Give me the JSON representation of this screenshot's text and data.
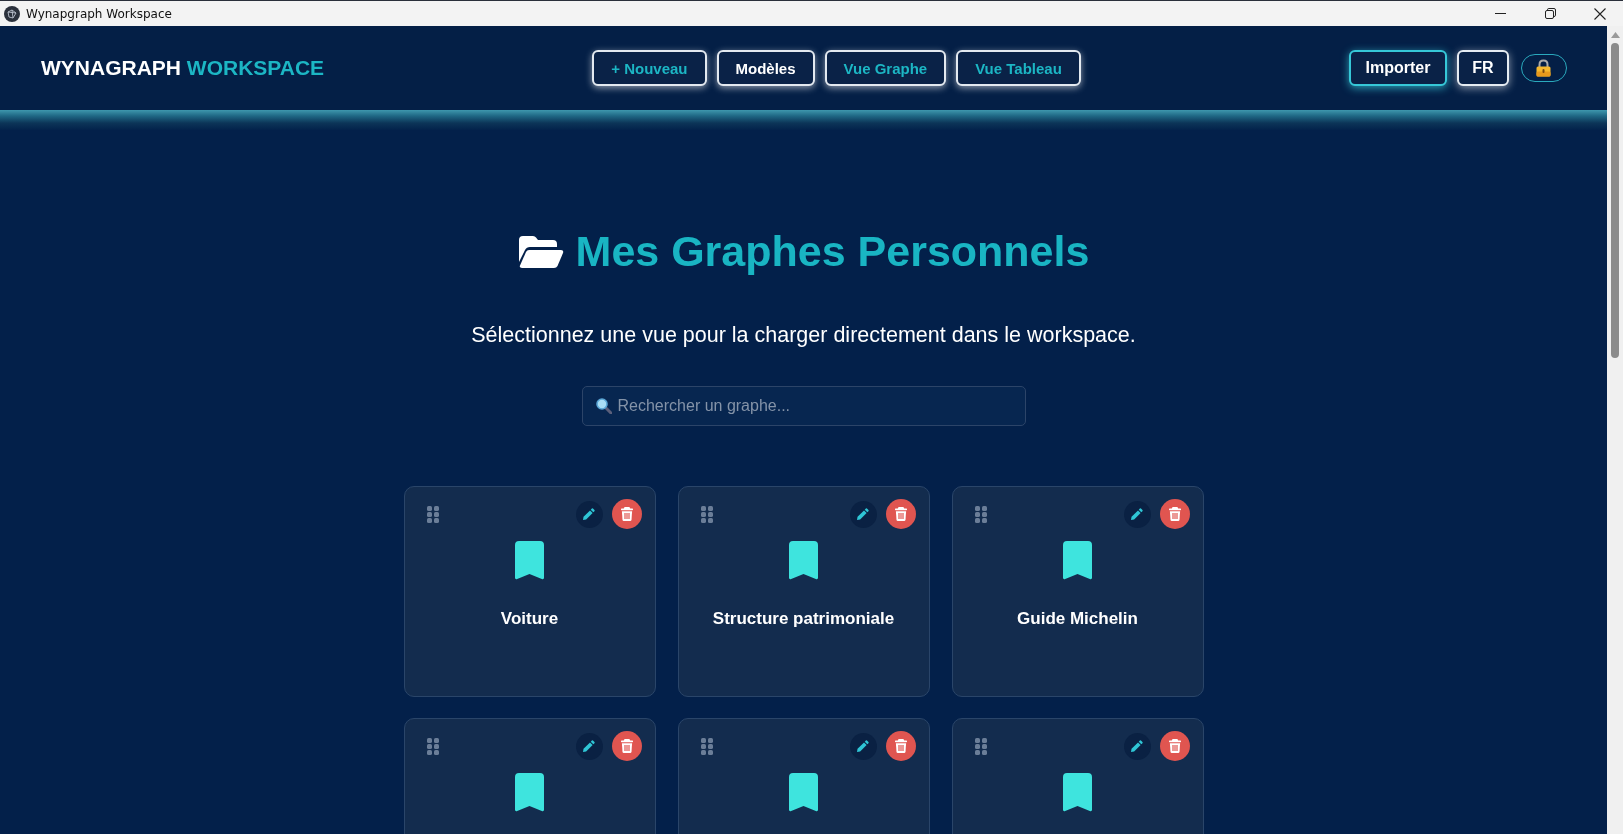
{
  "window": {
    "title": "Wynapgraph Workspace"
  },
  "header": {
    "logo": {
      "text": "WYNAGRAPH",
      "accent": "WORKSPACE"
    },
    "nav": [
      {
        "label": "+ Nouveau",
        "selected": false
      },
      {
        "label": "Modèles",
        "selected": true
      },
      {
        "label": "Vue Graphe",
        "selected": false
      },
      {
        "label": "Vue Tableau",
        "selected": false
      }
    ],
    "actions": [
      {
        "kind": "import",
        "label": "Importer"
      },
      {
        "kind": "language",
        "label": "FR"
      },
      {
        "kind": "lock"
      }
    ]
  },
  "main": {
    "title": "Mes Graphes Personnels",
    "subtitle": "Sélectionnez une vue pour la charger directement dans le workspace.",
    "search": {
      "placeholder": "Rechercher un graphe..."
    },
    "cards": [
      {
        "kind": "graph",
        "title": "Voiture"
      },
      {
        "kind": "graph",
        "title": "Structure patrimoniale"
      },
      {
        "kind": "graph",
        "title": "Guide Michelin"
      },
      {
        "kind": "graph"
      },
      {
        "kind": "graph"
      },
      {
        "kind": "graph"
      }
    ]
  }
}
